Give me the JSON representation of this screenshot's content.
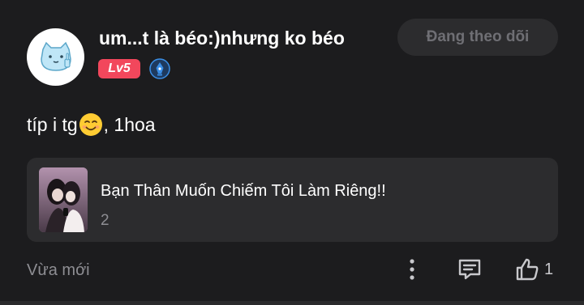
{
  "user": {
    "name": "um...t là béo:)nhưng ko béo",
    "level": "Lv5"
  },
  "follow_button": {
    "label": "Đang theo dõi"
  },
  "post": {
    "text_before": "típ i tg",
    "emoji": "smiling-face-emoji",
    "text_after": ", 1hoa"
  },
  "story": {
    "title": "Bạn Thân Muốn Chiếm Tôi Làm Riêng!!",
    "count": "2"
  },
  "footer": {
    "timestamp": "Vừa mới",
    "like_count": "1"
  },
  "colors": {
    "background": "#1c1c1e",
    "card": "#2c2c2e",
    "level_badge": "#f2475c",
    "muted_text": "#8e8e93",
    "verified_blue": "#3a8ee6"
  },
  "icons": {
    "avatar": "cat-middle-finger-icon",
    "verified": "verified-pen-badge-icon",
    "more": "more-vertical-icon",
    "comment": "comment-icon",
    "like": "thumbs-up-icon"
  }
}
